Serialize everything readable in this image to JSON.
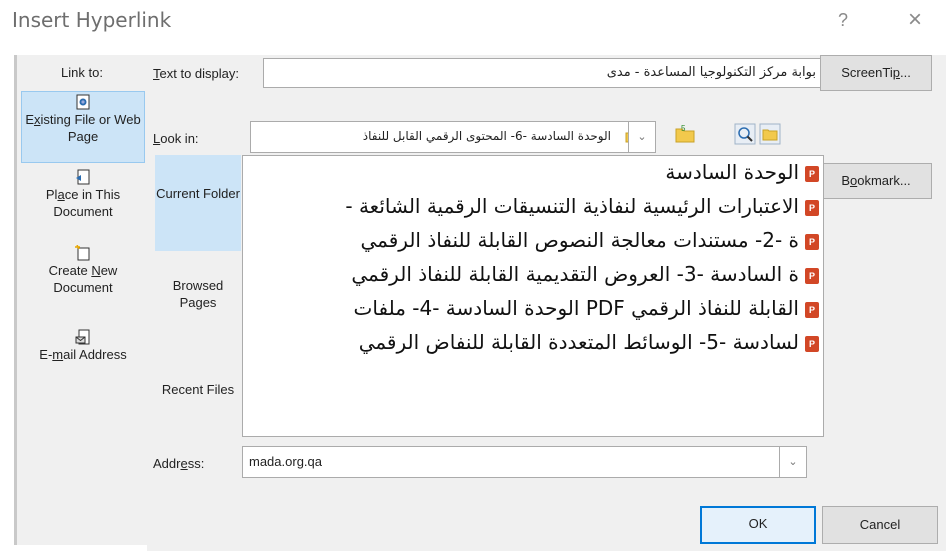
{
  "dialog": {
    "title": "Insert Hyperlink",
    "help_glyph": "?",
    "close_glyph": "×"
  },
  "link_to": {
    "label": "Link to:",
    "items": [
      {
        "label_pre": "E",
        "label_u": "x",
        "label_post": "isting File or Web Page",
        "icon": "existing-file-icon",
        "selected": true
      },
      {
        "label_pre": "Pl",
        "label_u": "a",
        "label_post": "ce in This Document",
        "icon": "place-in-document-icon",
        "selected": false
      },
      {
        "label_pre": "Create ",
        "label_u": "N",
        "label_post": "ew Document",
        "icon": "new-document-icon",
        "selected": false
      },
      {
        "label_pre": "E-",
        "label_u": "m",
        "label_post": "ail Address",
        "icon": "email-address-icon",
        "selected": false
      }
    ]
  },
  "text_to_display": {
    "label_u": "T",
    "label_post": "ext to display:",
    "value": "بوابة مركز التكنولوجيا المساعدة - مدى"
  },
  "screentip_button": {
    "label_pre": "ScreenTi",
    "label_u": "p",
    "label_post": "..."
  },
  "look_in": {
    "label_u": "L",
    "label_post": "ook in:",
    "value": "الوحدة السادسة -6- المحتوى الرقمي القابل للنفاذ"
  },
  "bookmark_button": {
    "label_pre": "B",
    "label_u": "o",
    "label_post": "okmark..."
  },
  "tabs": [
    {
      "label": "Current Folder",
      "selected": true
    },
    {
      "label": "Browsed Pages",
      "selected": false
    },
    {
      "label": "Recent Files",
      "selected": false
    }
  ],
  "files": [
    "الوحدة السادسة",
    "الاعتبارات الرئيسية لنفاذية التنسيقات الرقمية الشائعة -",
    "ة -2- مستندات معالجة النصوص القابلة للنفاذ الرقمي",
    "ة السادسة -3- العروض التقديمية القابلة للنفاذ الرقمي",
    "القابلة للنفاذ الرقمي PDF الوحدة السادسة -4- ملفات",
    "لسادسة -5- الوسائط المتعددة القابلة للنفاض الرقمي"
  ],
  "file_icon_text": "P",
  "address": {
    "label_pre": "Addr",
    "label_u": "e",
    "label_post": "ss:",
    "value": "mada.org.qa"
  },
  "ok_label": "OK",
  "cancel_label": "Cancel",
  "colors": {
    "selection": "#cce4f7",
    "ok_border": "#0078d7",
    "ppt_icon": "#d24726",
    "folder": "#f2c94c"
  }
}
